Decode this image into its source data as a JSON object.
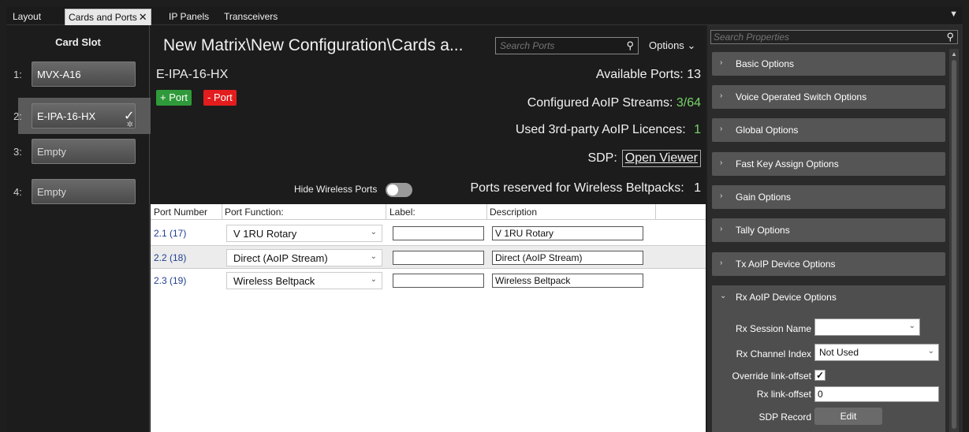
{
  "tabs": [
    {
      "label": "Layout"
    },
    {
      "label": "Cards and Ports"
    },
    {
      "label": "IP Panels"
    },
    {
      "label": "Transceivers"
    }
  ],
  "tab_close_glyph": "✕",
  "tab_menu_glyph": "▼",
  "card_slot": {
    "title": "Card Slot",
    "slots": [
      {
        "number": "1:",
        "name": "MVX-A16"
      },
      {
        "number": "2:",
        "name": "E-IPA-16-HX"
      },
      {
        "number": "3:",
        "name": "Empty"
      },
      {
        "number": "4:",
        "name": "Empty"
      }
    ]
  },
  "center": {
    "breadcrumb": "New Matrix\\New Configuration\\Cards a...",
    "search_placeholder": "Search Ports",
    "options_label": "Options",
    "card_name": "E-IPA-16-HX",
    "add_port": "+ Port",
    "remove_port": "- Port",
    "available_ports_label": "Available Ports:",
    "available_ports": "13",
    "configured_streams_label": "Configured AoIP Streams:",
    "configured_streams": "3/64",
    "used_licences_label": "Used 3rd-party AoIP Licences:",
    "used_licences": "1",
    "sdp_label": "SDP:",
    "open_viewer": "Open Viewer",
    "hide_wireless_label": "Hide Wireless Ports",
    "reserved_label": "Ports reserved for Wireless Beltpacks:",
    "reserved": "1",
    "table": {
      "headers": [
        "Port Number",
        "Port Function:",
        "Label:",
        "Description"
      ],
      "rows": [
        {
          "port": "2.1 (17)",
          "function": "V 1RU Rotary",
          "label": "",
          "description": "V 1RU Rotary"
        },
        {
          "port": "2.2 (18)",
          "function": "Direct (AoIP Stream)",
          "label": "",
          "description": "Direct (AoIP Stream)"
        },
        {
          "port": "2.3 (19)",
          "function": "Wireless Beltpack",
          "label": "",
          "description": "Wireless Beltpack"
        }
      ]
    }
  },
  "properties": {
    "search_placeholder": "Search Properties",
    "groups": [
      {
        "label": "Basic Options"
      },
      {
        "label": "Voice Operated Switch Options"
      },
      {
        "label": "Global Options"
      },
      {
        "label": "Fast Key Assign Options"
      },
      {
        "label": "Gain Options"
      },
      {
        "label": "Tally Options"
      },
      {
        "label": "Tx AoIP Device Options"
      },
      {
        "label": "Rx AoIP Device Options"
      }
    ],
    "rx": {
      "session_name_label": "Rx Session Name",
      "session_name_value": "",
      "channel_index_label": "Rx Channel Index",
      "channel_index_value": "Not Used",
      "override_label": "Override link-offset",
      "override_checked": true,
      "link_offset_label": "Rx link-offset",
      "link_offset_value": "0",
      "sdp_record_label": "SDP Record",
      "edit_label": "Edit"
    }
  },
  "colors": {
    "accent_green": "#79d46a",
    "add_button": "#2f9a3a",
    "remove_button": "#e31d1d",
    "link_blue": "#1f3f8f"
  }
}
